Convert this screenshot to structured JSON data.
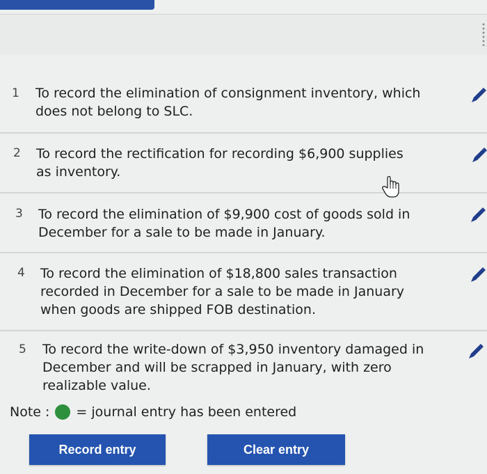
{
  "colors": {
    "accent_blue": "#2454b0",
    "status_green": "#2e8f3d",
    "background": "#eef0ef"
  },
  "entries": [
    {
      "number": "1",
      "lines": [
        "To record the elimination of consignment inventory, which",
        "does not belong to SLC."
      ],
      "icon": "pencil-edit-icon"
    },
    {
      "number": "2",
      "lines": [
        "To record the rectification for recording $6,900 supplies",
        "as inventory."
      ],
      "icon": "pencil-edit-icon"
    },
    {
      "number": "3",
      "lines": [
        "To record the elimination of $9,900 cost of goods sold in",
        "December for a sale to be made in January."
      ],
      "icon": "pencil-edit-icon"
    },
    {
      "number": "4",
      "lines": [
        "To record the elimination of $18,800 sales transaction",
        "recorded in December for a sale to be made in January",
        "when goods are shipped FOB destination."
      ],
      "icon": "pencil-edit-icon"
    },
    {
      "number": "5",
      "lines": [
        "To record the write-down of $3,950 inventory damaged in",
        "December and will be scrapped in January, with zero",
        "realizable value."
      ],
      "icon": "pencil-edit-icon"
    }
  ],
  "note": {
    "label": "Note :",
    "text": "= journal entry has been entered"
  },
  "buttons": {
    "record": "Record entry",
    "clear": "Clear entry"
  }
}
